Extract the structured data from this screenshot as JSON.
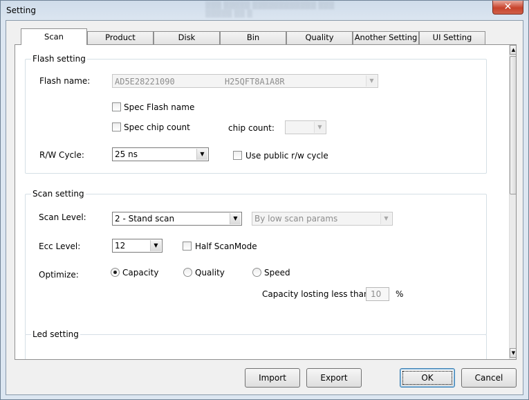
{
  "window": {
    "title": "Setting",
    "close_glyph": "✕"
  },
  "tabs": [
    "Scan",
    "Product",
    "Disk",
    "Bin",
    "Quality",
    "Another Setting",
    "UI Setting"
  ],
  "flash_setting": {
    "group_title": "Flash setting",
    "flash_name_label": "Flash name:",
    "flash_name_value": "AD5E28221090          H25QFT8A1A8R",
    "spec_flash_name_label": "Spec Flash name",
    "spec_flash_name_checked": false,
    "spec_chip_count_label": "Spec chip count",
    "spec_chip_count_checked": false,
    "chip_count_label": "chip count:",
    "chip_count_value": "",
    "rw_cycle_label": "R/W Cycle:",
    "rw_cycle_value": "25 ns",
    "use_public_label": "Use public r/w cycle",
    "use_public_checked": false
  },
  "scan_setting": {
    "group_title": "Scan setting",
    "scan_level_label": "Scan Level:",
    "scan_level_value": "2 - Stand scan",
    "scan_params_value": "By low scan params",
    "ecc_level_label": "Ecc Level:",
    "ecc_level_value": "12",
    "half_scan_label": "Half ScanMode",
    "half_scan_checked": false,
    "optimize_label": "Optimize:",
    "optimize_options": [
      "Capacity",
      "Quality",
      "Speed"
    ],
    "optimize_selected": "Capacity",
    "capacity_losting_label": "Capacity losting less than",
    "capacity_losting_value": "10",
    "capacity_losting_unit": "%"
  },
  "led_setting": {
    "group_title": "Led setting"
  },
  "buttons": {
    "import": "Import",
    "export": "Export",
    "ok": "OK",
    "cancel": "Cancel"
  },
  "icons": {
    "dropdown": "chevron-down-icon",
    "scroll_up": "scroll-up-icon",
    "scroll_down": "scroll-down-icon"
  }
}
